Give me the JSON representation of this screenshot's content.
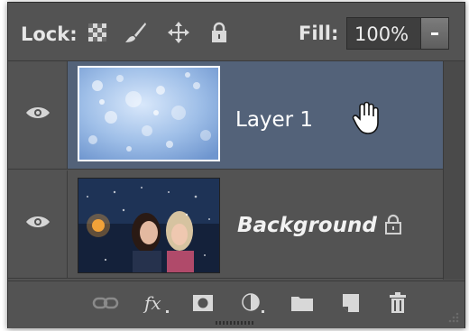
{
  "lock_bar": {
    "lock_label": "Lock:",
    "fill_label": "Fill:",
    "fill_value": "100%"
  },
  "layers": [
    {
      "name": "Layer 1",
      "selected": true,
      "visible": true,
      "locked": false
    },
    {
      "name": "Background",
      "selected": false,
      "visible": true,
      "locked": true
    }
  ],
  "icons": {
    "lock_transparent": "lock-transparent-pixels-icon",
    "lock_image": "lock-image-pixels-icon",
    "lock_position": "lock-position-icon",
    "lock_all": "lock-all-icon",
    "bottom": [
      "link-layers-icon",
      "layer-style-fx-icon",
      "add-mask-icon",
      "adjustment-layer-icon",
      "new-group-icon",
      "new-layer-icon",
      "delete-layer-icon"
    ]
  },
  "colors": {
    "panel_bg": "#535353",
    "selected_row": "#536279",
    "text": "#e6e6e6"
  }
}
